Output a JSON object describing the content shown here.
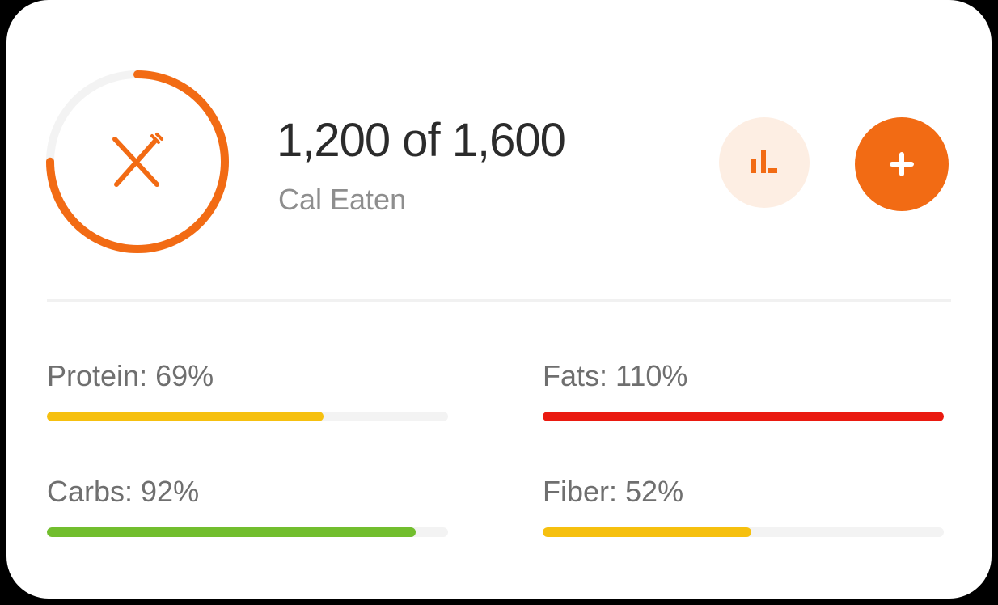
{
  "summary": {
    "eaten": "1,200",
    "goal": "1,600",
    "headline": "1,200 of 1,600",
    "subtitle": "Cal Eaten",
    "progress": 0.75
  },
  "icons": {
    "center": "fork-knife-icon",
    "stats": "bar-chart-icon",
    "add": "plus-icon"
  },
  "colors": {
    "accent": "#f26b14",
    "accent_light": "#fdeee3",
    "track": "#f3f3f3",
    "yellow": "#f6c00f",
    "red": "#ea1a10",
    "green": "#72be2e"
  },
  "macros": [
    {
      "label": "Protein: 69%",
      "percent": 69,
      "color": "#f6c00f",
      "track": "#f3f3f3"
    },
    {
      "label": "Fats: 110%",
      "percent": 110,
      "color": "#ea1a10",
      "track": "#f7c4c1"
    },
    {
      "label": "Carbs: 92%",
      "percent": 92,
      "color": "#72be2e",
      "track": "#f3f3f3"
    },
    {
      "label": "Fiber: 52%",
      "percent": 52,
      "color": "#f6c00f",
      "track": "#f3f3f3"
    }
  ]
}
